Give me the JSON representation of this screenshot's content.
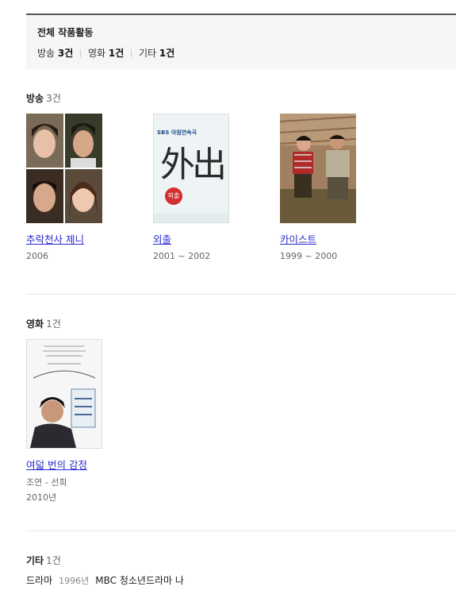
{
  "summary": {
    "title": "전체 작품활동",
    "broadcast_label": "방송",
    "broadcast_count": "3건",
    "movie_label": "영화",
    "movie_count": "1건",
    "etc_label": "기타",
    "etc_count": "1건"
  },
  "broadcast": {
    "heading": "방송",
    "count": "3건",
    "items": [
      {
        "title": "추락천사 제니",
        "year": "2006",
        "poster_icon": "four-portrait-collage"
      },
      {
        "title": "외출",
        "year": "2001 ~ 2002",
        "poster_icon": "calligraphy-poster",
        "poster_badge": "SBS 아침연속극",
        "poster_glyph": "外出",
        "poster_stamp": "외출"
      },
      {
        "title": "카이스트",
        "year": "1999 ~ 2000",
        "poster_icon": "two-people-sitting-photo"
      }
    ]
  },
  "movie": {
    "heading": "영화",
    "count": "1건",
    "items": [
      {
        "title": "여덟 번의 감정",
        "role": "조연 - 선희",
        "year": "2010년",
        "poster_icon": "movie-poster-man"
      }
    ]
  },
  "etc": {
    "heading": "기타",
    "count": "1건",
    "row": {
      "type": "드라마",
      "year": "1996년",
      "desc": "MBC 청소년드라마 나"
    }
  },
  "colors": {
    "link": "#2a2ad0",
    "summary_bg": "#f5f6f8",
    "summary_border": "#555555"
  }
}
